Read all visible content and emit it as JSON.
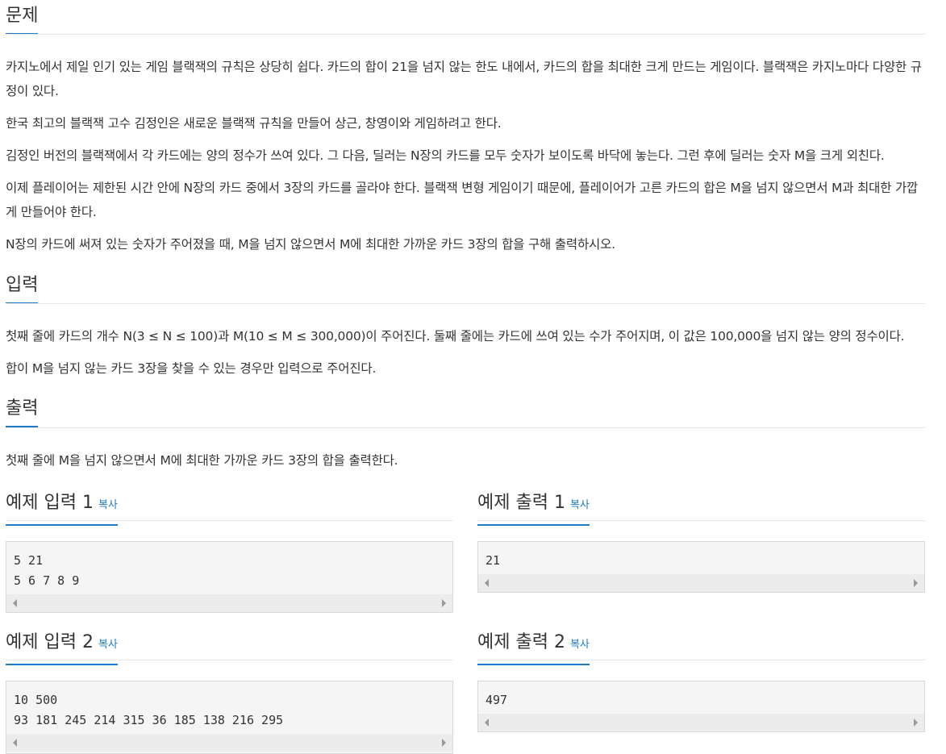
{
  "sections": {
    "problem": {
      "title": "문제",
      "paragraphs": [
        "카지노에서 제일 인기 있는 게임 블랙잭의 규칙은 상당히 쉽다. 카드의 합이 21을 넘지 않는 한도 내에서, 카드의 합을 최대한 크게 만드는 게임이다. 블랙잭은 카지노마다 다양한 규정이 있다.",
        "한국 최고의 블랙잭 고수 김정인은 새로운 블랙잭 규칙을 만들어 상근, 창영이와 게임하려고 한다.",
        "김정인 버전의 블랙잭에서 각 카드에는 양의 정수가 쓰여 있다. 그 다음, 딜러는 N장의 카드를 모두 숫자가 보이도록 바닥에 놓는다. 그런 후에 딜러는 숫자 M을 크게 외친다.",
        "이제 플레이어는 제한된 시간 안에 N장의 카드 중에서 3장의 카드를 골라야 한다. 블랙잭 변형 게임이기 때문에, 플레이어가 고른 카드의 합은 M을 넘지 않으면서 M과 최대한 가깝게 만들어야 한다.",
        "N장의 카드에 써져 있는 숫자가 주어졌을 때, M을 넘지 않으면서 M에 최대한 가까운 카드 3장의 합을 구해 출력하시오."
      ]
    },
    "input": {
      "title": "입력",
      "paragraphs": [
        "첫째 줄에 카드의 개수 N(3 ≤ N ≤ 100)과 M(10 ≤ M ≤ 300,000)이 주어진다. 둘째 줄에는 카드에 쓰여 있는 수가 주어지며, 이 값은 100,000을 넘지 않는 양의 정수이다.",
        "합이 M을 넘지 않는 카드 3장을 찾을 수 있는 경우만 입력으로 주어진다."
      ]
    },
    "output": {
      "title": "출력",
      "paragraphs": [
        "첫째 줄에 M을 넘지 않으면서 M에 최대한 가까운 카드 3장의 합을 출력한다."
      ]
    }
  },
  "examples": {
    "copy_label": "복사",
    "in1_title": "예제 입력 1",
    "out1_title": "예제 출력 1",
    "in2_title": "예제 입력 2",
    "out2_title": "예제 출력 2",
    "in1_code": "5 21\n5 6 7 8 9",
    "out1_code": "21",
    "in2_code": "10 500\n93 181 245 214 315 36 185 138 216 295",
    "out2_code": "497"
  },
  "colors": {
    "accent": "#1d7bc7",
    "text": "#333333",
    "pre_bg": "#f5f5f5"
  }
}
